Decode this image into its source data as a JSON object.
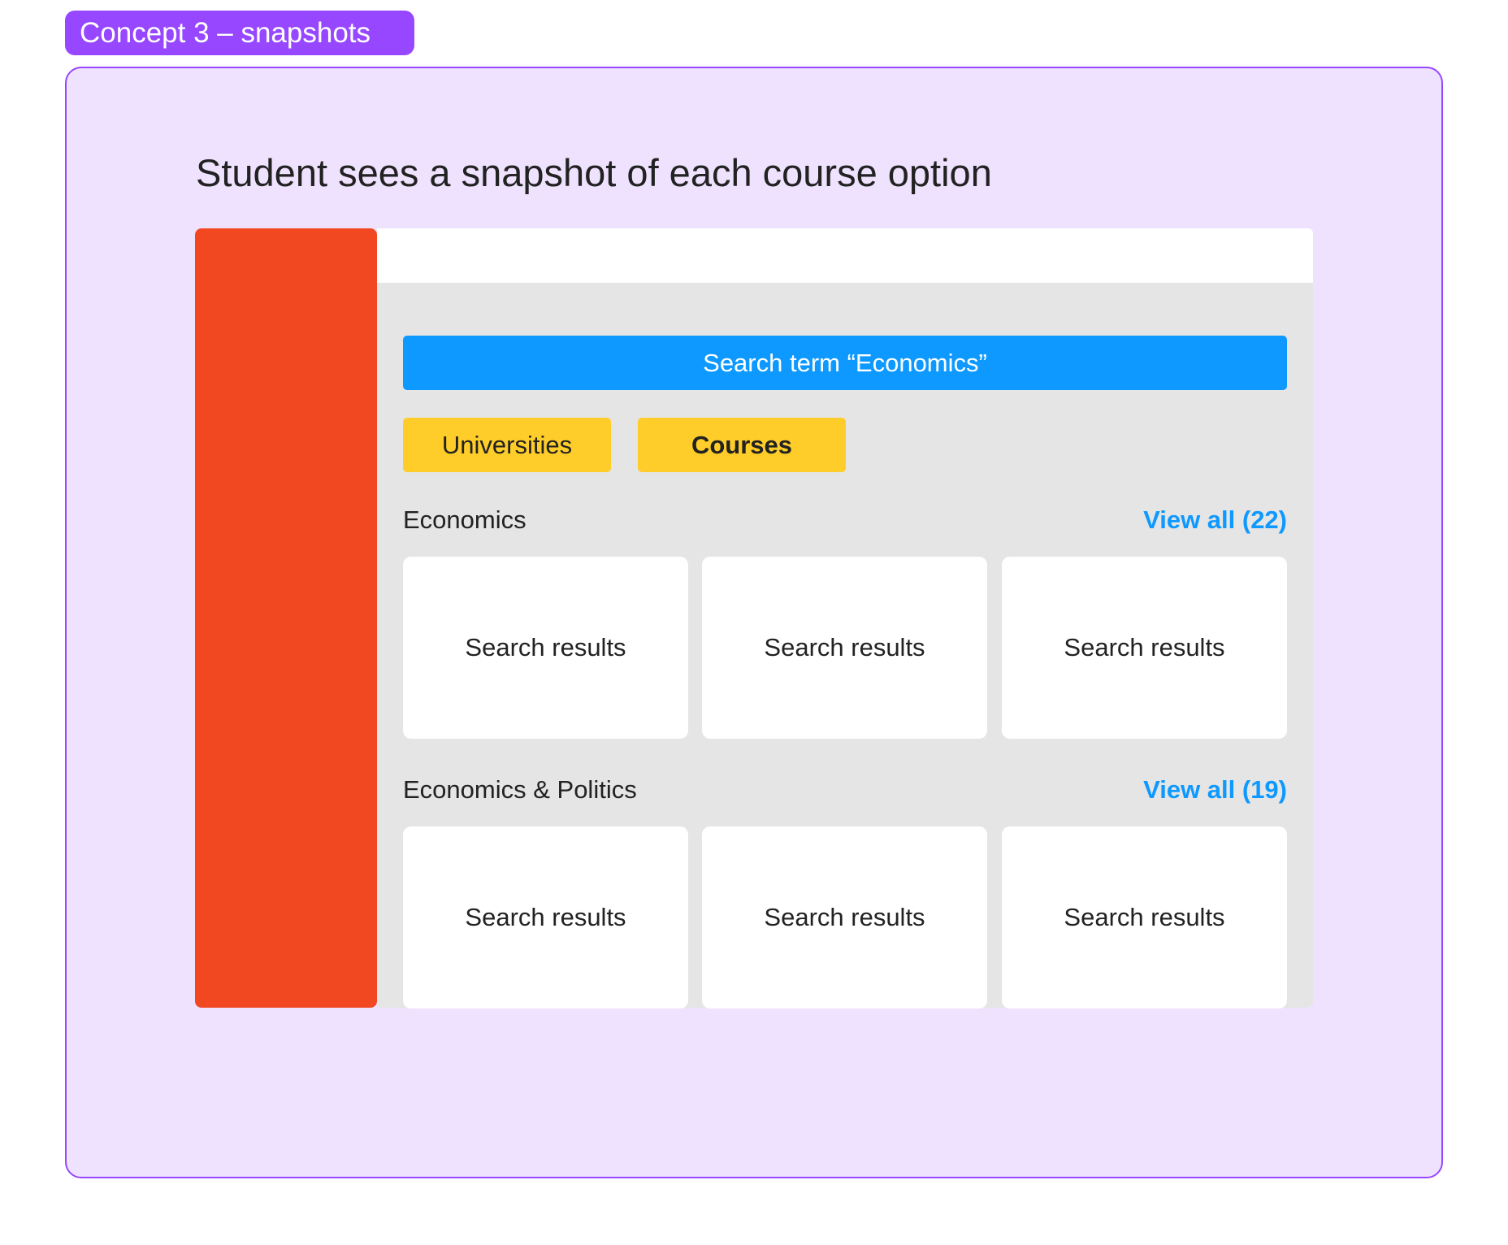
{
  "frame_tag": "Concept 3 – snapshots",
  "heading": "Student sees a snapshot of each course option",
  "colors": {
    "tag": "#9747ff",
    "frame_background": "#efe2fe",
    "sidebar": "#f24822",
    "search_bar": "#0d99ff",
    "tabs": "#ffcd29",
    "panel": "#e5e5e5",
    "link": "#0d99ff"
  },
  "search": {
    "label": "Search term “Economics”"
  },
  "tabs": [
    {
      "label": "Universities",
      "active": false
    },
    {
      "label": "Courses",
      "active": true
    }
  ],
  "sections": [
    {
      "title": "Economics",
      "view_all": "View all (22)",
      "cards": [
        "Search results",
        "Search results",
        "Search results"
      ]
    },
    {
      "title": "Economics & Politics",
      "view_all": "View all (19)",
      "cards": [
        "Search results",
        "Search results",
        "Search results"
      ]
    }
  ]
}
